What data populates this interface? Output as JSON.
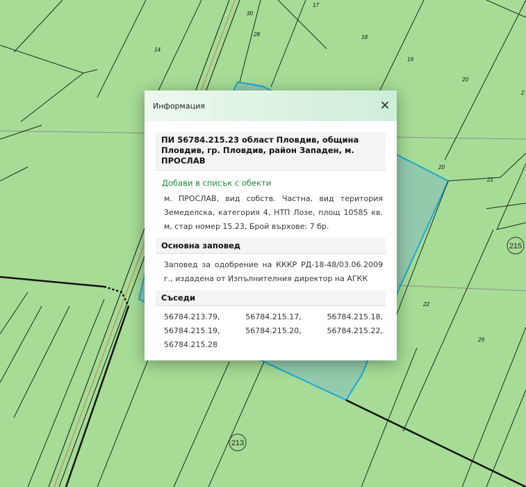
{
  "map": {
    "background_color": "#a6dc96",
    "parcel_line_color": "#111111",
    "highlight_color": "#1aa8d8",
    "road_color": "#b89a6a",
    "parcel_labels": [
      "17",
      "30",
      "28",
      "18",
      "14",
      "19",
      "20",
      "2",
      "20",
      "21",
      "22",
      "29",
      "215",
      "213"
    ]
  },
  "popup": {
    "title": "Информация",
    "close_icon": "close-icon",
    "parcel_heading": "ПИ 56784.215.23 област Пловдив, община Пловдив, гр. Пловдив, район Западен, м. ПРОСЛАВ",
    "add_link": "Добави в списък с обекти",
    "details": "м. ПРОСЛАВ, вид собств. Частна, вид територия Земеделска, категория 4, НТП Лозе, площ 10585 кв. м, стар номер 15.23, Брой върхове: 7 бр.",
    "order_heading": "Основна заповед",
    "order_text": "Заповед за одобрение на КККР РД-18-48/03.06.2009 г., издадена от Изпълнителния директор на АГКК",
    "neighbors_heading": "Съседи",
    "neighbors_text": "56784.213.79, 56784.215.17, 56784.215.18, 56784.215.19, 56784.215.20, 56784.215.22, 56784.215.28"
  }
}
